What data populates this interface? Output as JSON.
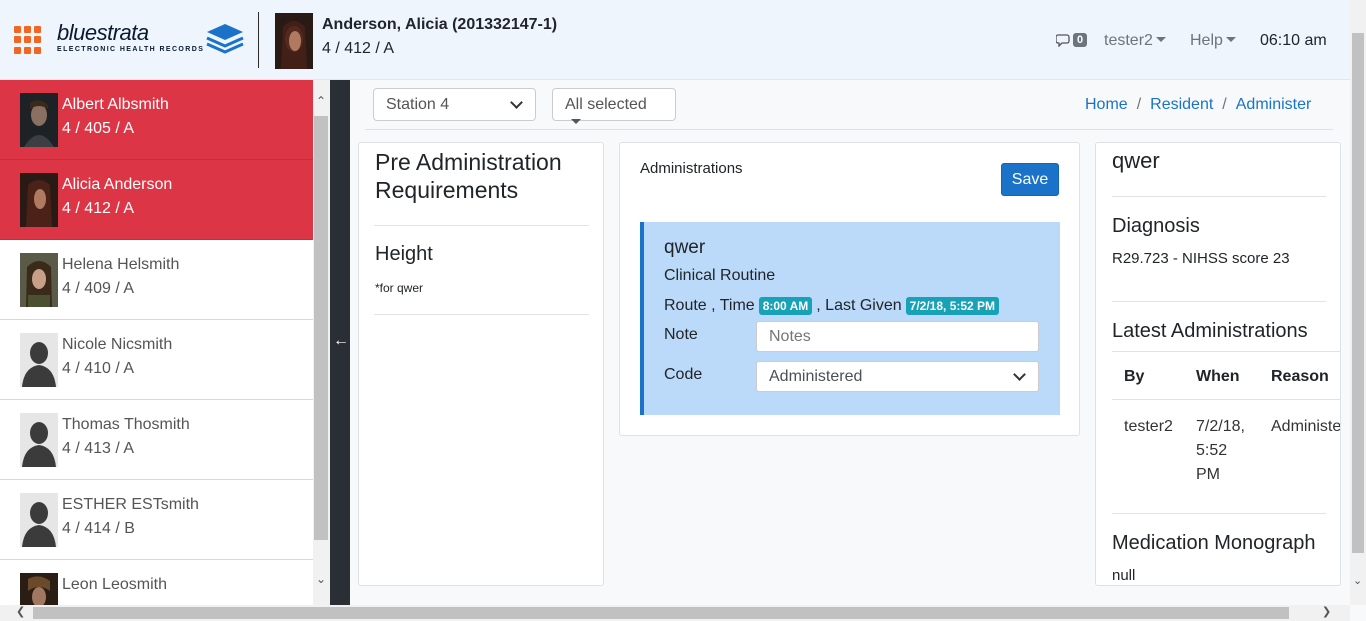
{
  "header": {
    "logo_word": "bluestrata",
    "logo_sub": "ELECTRONIC HEALTH RECORDS",
    "patient_name": "Anderson, Alicia (201332147-1)",
    "patient_loc": "4 / 412 / A",
    "messages_count": "0",
    "user_menu": "tester2",
    "help_menu": "Help",
    "time": "06:10 am"
  },
  "patients": [
    {
      "name": "Albert Albsmith",
      "loc": "4 / 405 / A",
      "active": true,
      "photo": "photo"
    },
    {
      "name": "Alicia Anderson",
      "loc": "4 / 412 / A",
      "active": true,
      "photo": "photo"
    },
    {
      "name": "Helena Helsmith",
      "loc": "4 / 409 / A",
      "active": false,
      "photo": "photo"
    },
    {
      "name": "Nicole Nicsmith",
      "loc": "4 / 410 / A",
      "active": false,
      "photo": "silhouette"
    },
    {
      "name": "Thomas Thosmith",
      "loc": "4 / 413 / A",
      "active": false,
      "photo": "silhouette"
    },
    {
      "name": "ESTHER ESTsmith",
      "loc": "4 / 414 / B",
      "active": false,
      "photo": "silhouette"
    },
    {
      "name": "Leon Leosmith",
      "loc": "",
      "active": false,
      "photo": "photo"
    }
  ],
  "toolbar": {
    "station": "Station 4",
    "filter": "All selected",
    "breadcrumb": [
      "Home",
      "Resident",
      "Administer"
    ]
  },
  "pre_admin": {
    "title_line1": "Pre Administration",
    "title_line2": "Requirements",
    "requirement": "Height",
    "requirement_note": "*for qwer"
  },
  "administrations": {
    "label": "Administrations",
    "save_label": "Save",
    "card": {
      "title": "qwer",
      "subtitle": "Clinical Routine",
      "route_text": "Route , Time",
      "time_badge": "8:00 AM",
      "last_given_text": ", Last Given",
      "last_given_badge": "7/2/18, 5:52 PM",
      "note_label": "Note",
      "note_placeholder": "Notes",
      "code_label": "Code",
      "code_value": "Administered"
    }
  },
  "details": {
    "title": "qwer",
    "diagnosis_head": "Diagnosis",
    "diagnosis_text": "R29.723 - NIHSS score 23",
    "latest_head": "Latest Administrations",
    "columns": [
      "By",
      "When",
      "Reason"
    ],
    "row": {
      "by": "tester2",
      "when_line1": "7/2/18,",
      "when_line2": "5:52",
      "when_line3": "PM",
      "reason": "Administered"
    },
    "monograph_head": "Medication Monograph",
    "monograph_text": "null"
  }
}
